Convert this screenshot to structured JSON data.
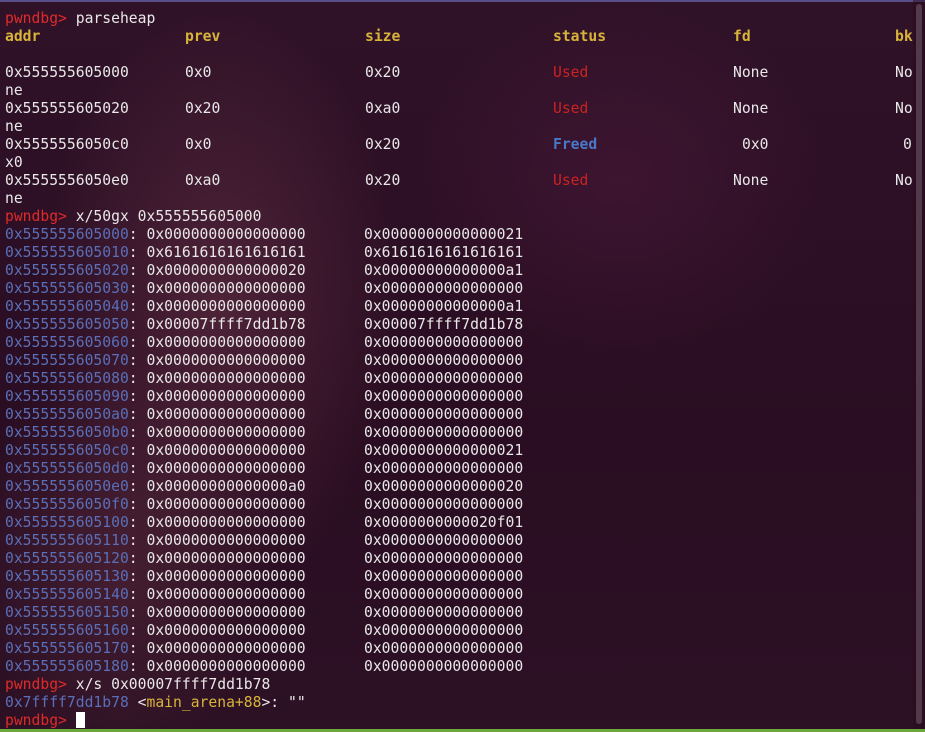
{
  "prompt": "pwndbg>",
  "commands": {
    "c1": "parseheap",
    "c2": "x/50gx 0x555555605000",
    "c3": "x/s 0x00007ffff7dd1b78"
  },
  "heap_table": {
    "headers": [
      "addr",
      "prev",
      "size",
      "status",
      "fd",
      "bk"
    ],
    "rows": [
      {
        "addr": "0x555555605000",
        "prev": "0x0",
        "size": "0x20",
        "status": "Used",
        "fd": "None",
        "bk": "No",
        "wrap": "ne"
      },
      {
        "addr": "0x555555605020",
        "prev": "0x20",
        "size": "0xa0",
        "status": "Used",
        "fd": "None",
        "bk": "No",
        "wrap": "ne"
      },
      {
        "addr": "0x5555556050c0",
        "prev": "0x0",
        "size": "0x20",
        "status": "Freed",
        "fd": "0x0",
        "bk": "0",
        "wrap": "x0"
      },
      {
        "addr": "0x5555556050e0",
        "prev": "0xa0",
        "size": "0x20",
        "status": "Used",
        "fd": "None",
        "bk": "No",
        "wrap": "ne"
      }
    ]
  },
  "memdump": [
    {
      "addr": "0x555555605000",
      "v1": "0x0000000000000000",
      "v2": "0x0000000000000021"
    },
    {
      "addr": "0x555555605010",
      "v1": "0x6161616161616161",
      "v2": "0x6161616161616161"
    },
    {
      "addr": "0x555555605020",
      "v1": "0x0000000000000020",
      "v2": "0x00000000000000a1"
    },
    {
      "addr": "0x555555605030",
      "v1": "0x0000000000000000",
      "v2": "0x0000000000000000"
    },
    {
      "addr": "0x555555605040",
      "v1": "0x0000000000000000",
      "v2": "0x00000000000000a1"
    },
    {
      "addr": "0x555555605050",
      "v1": "0x00007ffff7dd1b78",
      "v2": "0x00007ffff7dd1b78"
    },
    {
      "addr": "0x555555605060",
      "v1": "0x0000000000000000",
      "v2": "0x0000000000000000"
    },
    {
      "addr": "0x555555605070",
      "v1": "0x0000000000000000",
      "v2": "0x0000000000000000"
    },
    {
      "addr": "0x555555605080",
      "v1": "0x0000000000000000",
      "v2": "0x0000000000000000"
    },
    {
      "addr": "0x555555605090",
      "v1": "0x0000000000000000",
      "v2": "0x0000000000000000"
    },
    {
      "addr": "0x5555556050a0",
      "v1": "0x0000000000000000",
      "v2": "0x0000000000000000"
    },
    {
      "addr": "0x5555556050b0",
      "v1": "0x0000000000000000",
      "v2": "0x0000000000000000"
    },
    {
      "addr": "0x5555556050c0",
      "v1": "0x0000000000000000",
      "v2": "0x0000000000000021"
    },
    {
      "addr": "0x5555556050d0",
      "v1": "0x0000000000000000",
      "v2": "0x0000000000000000"
    },
    {
      "addr": "0x5555556050e0",
      "v1": "0x00000000000000a0",
      "v2": "0x0000000000000020"
    },
    {
      "addr": "0x5555556050f0",
      "v1": "0x0000000000000000",
      "v2": "0x0000000000000000"
    },
    {
      "addr": "0x555555605100",
      "v1": "0x0000000000000000",
      "v2": "0x0000000000020f01"
    },
    {
      "addr": "0x555555605110",
      "v1": "0x0000000000000000",
      "v2": "0x0000000000000000"
    },
    {
      "addr": "0x555555605120",
      "v1": "0x0000000000000000",
      "v2": "0x0000000000000000"
    },
    {
      "addr": "0x555555605130",
      "v1": "0x0000000000000000",
      "v2": "0x0000000000000000"
    },
    {
      "addr": "0x555555605140",
      "v1": "0x0000000000000000",
      "v2": "0x0000000000000000"
    },
    {
      "addr": "0x555555605150",
      "v1": "0x0000000000000000",
      "v2": "0x0000000000000000"
    },
    {
      "addr": "0x555555605160",
      "v1": "0x0000000000000000",
      "v2": "0x0000000000000000"
    },
    {
      "addr": "0x555555605170",
      "v1": "0x0000000000000000",
      "v2": "0x0000000000000000"
    },
    {
      "addr": "0x555555605180",
      "v1": "0x0000000000000000",
      "v2": "0x0000000000000000"
    }
  ],
  "string_result": {
    "addr": "0x7ffff7dd1b78",
    "open": "<",
    "symbol": "main_arena+88",
    "close": ">:",
    "value": "\"\""
  },
  "colors": {
    "prompt": "#e02a2a",
    "header": "#d8b43a",
    "address": "#5a6fb8",
    "used": "#cc2222",
    "freed": "#4a78c8"
  }
}
